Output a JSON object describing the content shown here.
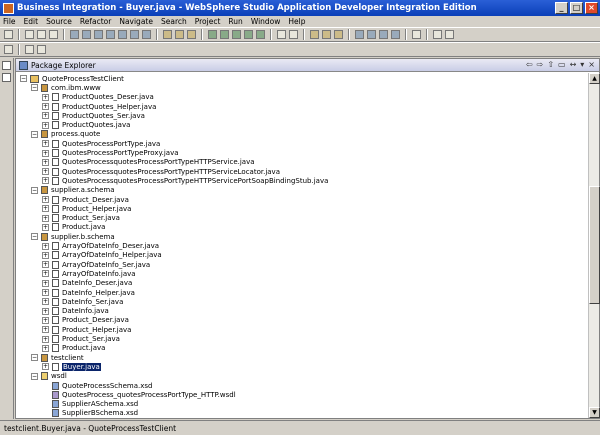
{
  "window": {
    "title": "Business Integration - Buyer.java - WebSphere Studio Application Developer Integration Edition"
  },
  "menu": [
    "File",
    "Edit",
    "Source",
    "Refactor",
    "Navigate",
    "Search",
    "Project",
    "Run",
    "Window",
    "Help"
  ],
  "panel": {
    "title": "Package Explorer"
  },
  "tree": [
    {
      "label": "QuoteProcessTestClient",
      "depth": 0,
      "icon": "project-icon",
      "expanded": true
    },
    {
      "label": "com.ibm.www",
      "depth": 1,
      "icon": "package-icon",
      "expanded": true
    },
    {
      "label": "ProductQuotes_Deser.java",
      "depth": 2,
      "icon": "java-file-icon",
      "expanded": false
    },
    {
      "label": "ProductQuotes_Helper.java",
      "depth": 2,
      "icon": "java-file-icon",
      "expanded": false
    },
    {
      "label": "ProductQuotes_Ser.java",
      "depth": 2,
      "icon": "java-file-icon",
      "expanded": false
    },
    {
      "label": "ProductQuotes.java",
      "depth": 2,
      "icon": "java-file-icon",
      "expanded": false
    },
    {
      "label": "process.quote",
      "depth": 1,
      "icon": "package-icon",
      "expanded": true
    },
    {
      "label": "QuotesProcessPortType.java",
      "depth": 2,
      "icon": "java-file-icon",
      "expanded": false
    },
    {
      "label": "QuotesProcessPortTypeProxy.java",
      "depth": 2,
      "icon": "java-file-icon",
      "expanded": false
    },
    {
      "label": "QuotesProcessquotesProcessPortTypeHTTPService.java",
      "depth": 2,
      "icon": "java-file-icon",
      "expanded": false
    },
    {
      "label": "QuotesProcessquotesProcessPortTypeHTTPServiceLocator.java",
      "depth": 2,
      "icon": "java-file-icon",
      "expanded": false
    },
    {
      "label": "QuotesProcessquotesProcessPortTypeHTTPServicePortSoapBindingStub.java",
      "depth": 2,
      "icon": "java-file-icon",
      "expanded": false
    },
    {
      "label": "supplier.a.schema",
      "depth": 1,
      "icon": "package-icon",
      "expanded": true
    },
    {
      "label": "Product_Deser.java",
      "depth": 2,
      "icon": "java-file-icon",
      "expanded": false
    },
    {
      "label": "Product_Helper.java",
      "depth": 2,
      "icon": "java-file-icon",
      "expanded": false
    },
    {
      "label": "Product_Ser.java",
      "depth": 2,
      "icon": "java-file-icon",
      "expanded": false
    },
    {
      "label": "Product.java",
      "depth": 2,
      "icon": "java-file-icon",
      "expanded": false
    },
    {
      "label": "supplier.b.schema",
      "depth": 1,
      "icon": "package-icon",
      "expanded": true
    },
    {
      "label": "ArrayOfDateInfo_Deser.java",
      "depth": 2,
      "icon": "java-file-icon",
      "expanded": false
    },
    {
      "label": "ArrayOfDateInfo_Helper.java",
      "depth": 2,
      "icon": "java-file-icon",
      "expanded": false
    },
    {
      "label": "ArrayOfDateInfo_Ser.java",
      "depth": 2,
      "icon": "java-file-icon",
      "expanded": false
    },
    {
      "label": "ArrayOfDateInfo.java",
      "depth": 2,
      "icon": "java-file-icon",
      "expanded": false
    },
    {
      "label": "DateInfo_Deser.java",
      "depth": 2,
      "icon": "java-file-icon",
      "expanded": false
    },
    {
      "label": "DateInfo_Helper.java",
      "depth": 2,
      "icon": "java-file-icon",
      "expanded": false
    },
    {
      "label": "DateInfo_Ser.java",
      "depth": 2,
      "icon": "java-file-icon",
      "expanded": false
    },
    {
      "label": "DateInfo.java",
      "depth": 2,
      "icon": "java-file-icon",
      "expanded": false
    },
    {
      "label": "Product_Deser.java",
      "depth": 2,
      "icon": "java-file-icon",
      "expanded": false
    },
    {
      "label": "Product_Helper.java",
      "depth": 2,
      "icon": "java-file-icon",
      "expanded": false
    },
    {
      "label": "Product_Ser.java",
      "depth": 2,
      "icon": "java-file-icon",
      "expanded": false
    },
    {
      "label": "Product.java",
      "depth": 2,
      "icon": "java-file-icon",
      "expanded": false
    },
    {
      "label": "testclient",
      "depth": 1,
      "icon": "package-icon",
      "expanded": true
    },
    {
      "label": "Buyer.java",
      "depth": 2,
      "icon": "java-file-icon",
      "expanded": false,
      "selected": true
    },
    {
      "label": "wsdl",
      "depth": 1,
      "icon": "folder-icon",
      "expanded": true
    },
    {
      "label": "QuoteProcessSchema.xsd",
      "depth": 2,
      "icon": "xsd-file-icon",
      "leaf": true
    },
    {
      "label": "QuotesProcess_quotesProcessPortType_HTTP.wsdl",
      "depth": 2,
      "icon": "wsdl-file-icon",
      "leaf": true
    },
    {
      "label": "SupplierASchema.xsd",
      "depth": 2,
      "icon": "xsd-file-icon",
      "leaf": true
    },
    {
      "label": "SupplierBSchema.xsd",
      "depth": 2,
      "icon": "xsd-file-icon",
      "leaf": true
    }
  ],
  "status": {
    "text": "testclient.Buyer.java - QuoteProcessTestClient"
  },
  "colors": {
    "titlebar": "#0a3fb8",
    "selection": "#0a246a",
    "chrome": "#d4d0c8"
  }
}
